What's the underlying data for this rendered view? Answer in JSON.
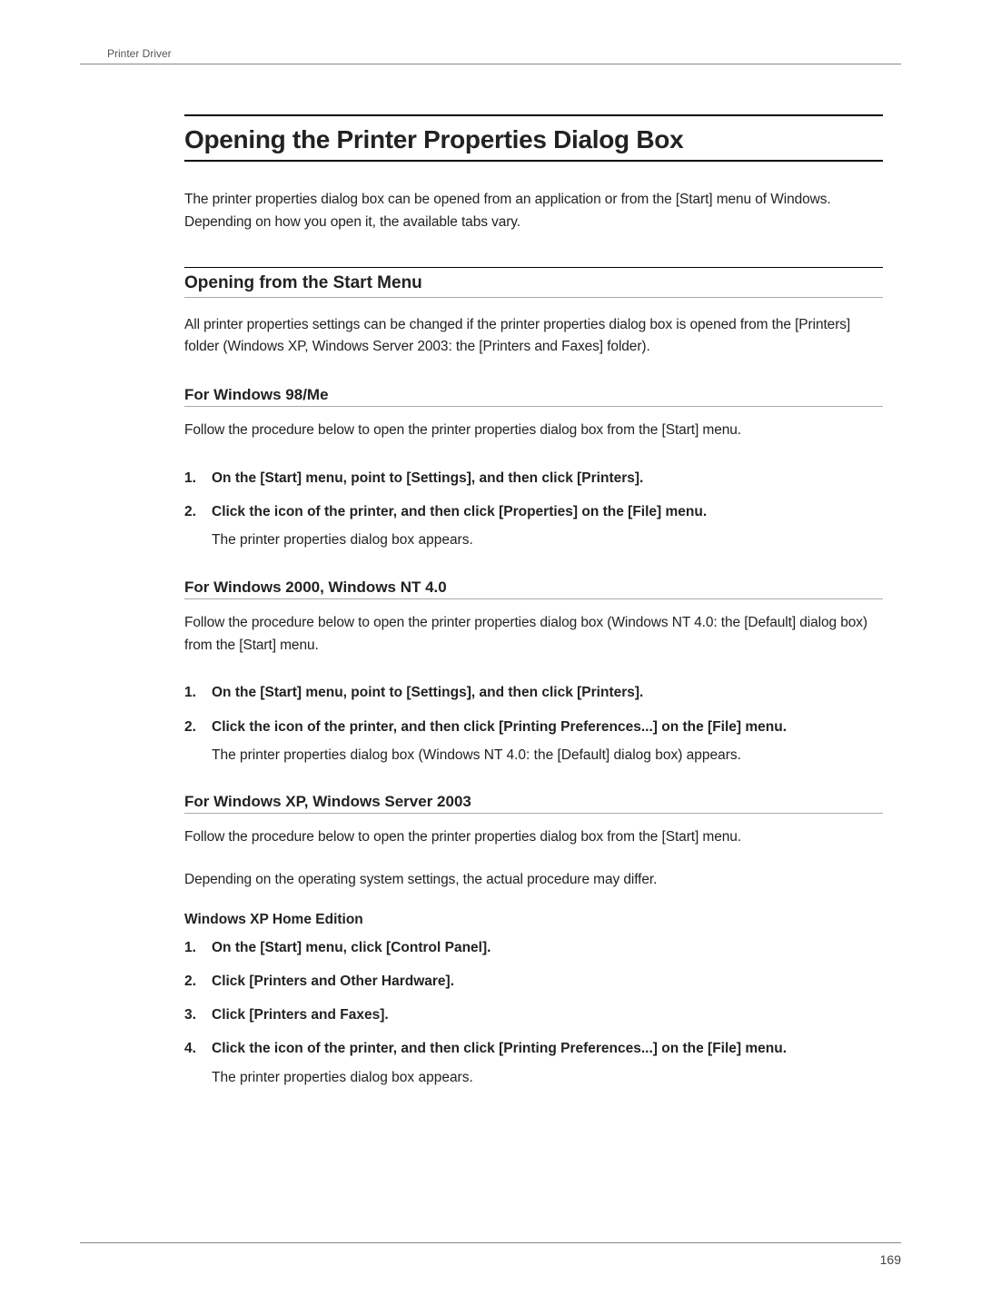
{
  "running_header": "Printer Driver",
  "title": "Opening the Printer Properties Dialog Box",
  "intro": "The printer properties dialog box can be opened from an application or from the [Start] menu of Windows. Depending on how you open it, the available tabs vary.",
  "section1": {
    "title": "Opening from the Start Menu",
    "intro": "All printer properties settings can be changed if the printer properties dialog box is opened from the [Printers] folder (Windows XP, Windows Server 2003: the [Printers and Faxes] folder).",
    "sub1": {
      "title": "For Windows 98/Me",
      "intro": "Follow the procedure below to open the printer properties dialog box from the [Start] menu.",
      "steps": [
        {
          "text": "On the [Start] menu, point to [Settings], and then click [Printers]."
        },
        {
          "text": "Click the icon of the printer, and then click [Properties] on the [File] menu.",
          "sub": "The printer properties dialog box appears."
        }
      ]
    },
    "sub2": {
      "title": "For Windows 2000, Windows NT 4.0",
      "intro": "Follow the procedure below to open the printer properties dialog box (Windows NT 4.0: the [Default] dialog box) from the [Start] menu.",
      "steps": [
        {
          "text": "On the [Start] menu, point to [Settings], and then click [Printers]."
        },
        {
          "text": "Click the icon of the printer, and then click [Printing Preferences...] on the [File] menu.",
          "sub": "The printer properties dialog box (Windows NT 4.0: the [Default] dialog box) appears."
        }
      ]
    },
    "sub3": {
      "title": "For Windows XP, Windows Server 2003",
      "intro1": "Follow the procedure below to open the printer properties dialog box from the [Start] menu.",
      "intro2": "Depending on the operating system settings, the actual procedure may differ.",
      "heading": "Windows XP Home Edition",
      "steps": [
        {
          "text": "On the [Start] menu, click [Control Panel]."
        },
        {
          "text": "Click [Printers and Other Hardware]."
        },
        {
          "text": "Click [Printers and Faxes]."
        },
        {
          "text": "Click the icon of the printer, and then click [Printing Preferences...] on the [File] menu.",
          "sub": "The printer properties dialog box appears."
        }
      ]
    }
  },
  "page_number": "169"
}
